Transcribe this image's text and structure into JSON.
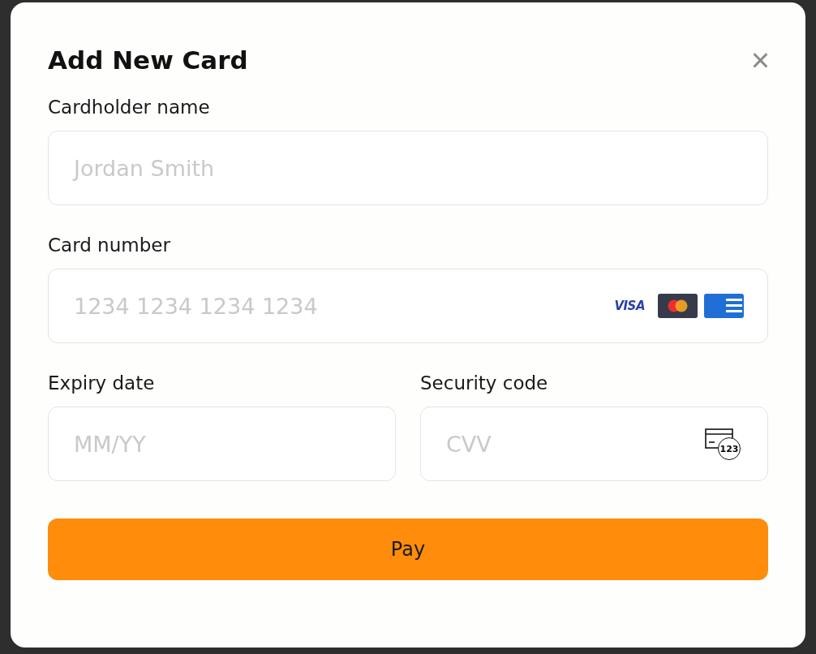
{
  "dialog": {
    "title": "Add New Card",
    "close": "×"
  },
  "fields": [
    {
      "kind": "text",
      "label": "Cardholder name",
      "placeholder": "Jordan Smith"
    },
    {
      "kind": "card",
      "label": "Card number",
      "placeholder": "1234 1234 1234 1234",
      "brand_text": "VISA"
    },
    {
      "kind": "expiry",
      "label": "Expiry date",
      "placeholder": "MM/YY"
    },
    {
      "kind": "cvv",
      "label": "Security code",
      "placeholder": "CVV",
      "badge": "123"
    }
  ],
  "button": {
    "label": "Pay"
  }
}
